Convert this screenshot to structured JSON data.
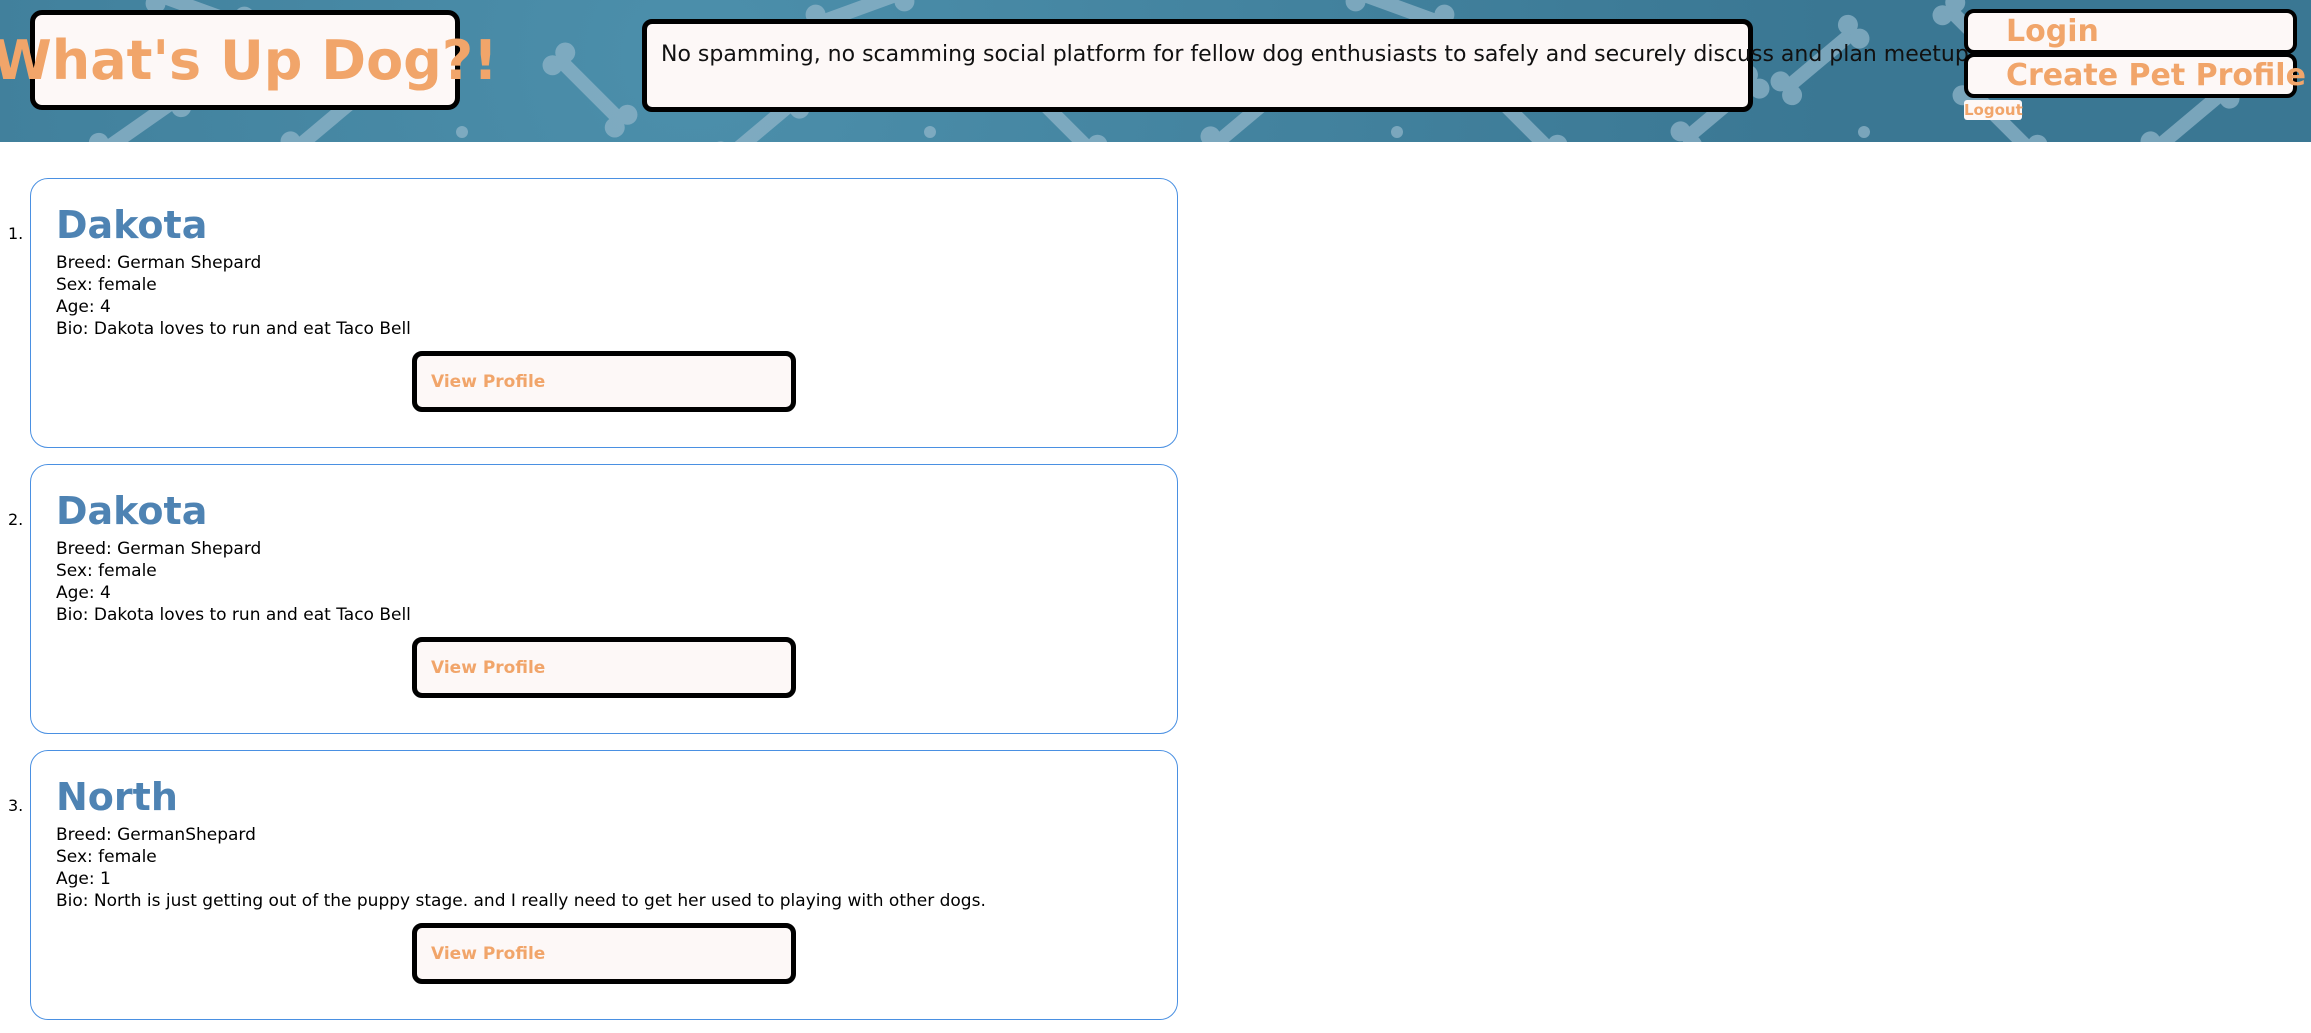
{
  "header": {
    "logo_text": "What's Up Dog?!",
    "tagline": "No spamming, no scamming social platform for fellow dog enthusiasts to safely and securely discuss and plan meetups!",
    "nav": {
      "login_label": "Login",
      "create_label": "Create Pet Profile",
      "logout_label": "Logout"
    }
  },
  "pets": [
    {
      "number": "1.",
      "name": "Dakota",
      "breed": "Breed: German Shepard",
      "sex": "Sex: female",
      "age": "Age: 4",
      "bio": "Bio: Dakota loves to run and eat Taco Bell",
      "button_label": "View Profile"
    },
    {
      "number": "2.",
      "name": "Dakota",
      "breed": "Breed: German Shepard",
      "sex": "Sex: female",
      "age": "Age: 4",
      "bio": "Bio: Dakota loves to run and eat Taco Bell",
      "button_label": "View Profile"
    },
    {
      "number": "3.",
      "name": "North",
      "breed": "Breed: GermanShepard",
      "sex": "Sex: female",
      "age": "Age: 1",
      "bio": "Bio: North is just getting out of the puppy stage. and I really need to get her used to playing with other dogs.",
      "button_label": "View Profile"
    }
  ],
  "colors": {
    "accent_orange": "#f1a56a",
    "pet_name_blue": "#4e83b3",
    "card_border": "#4a90e2",
    "header_bg": "#3f7e9a"
  }
}
